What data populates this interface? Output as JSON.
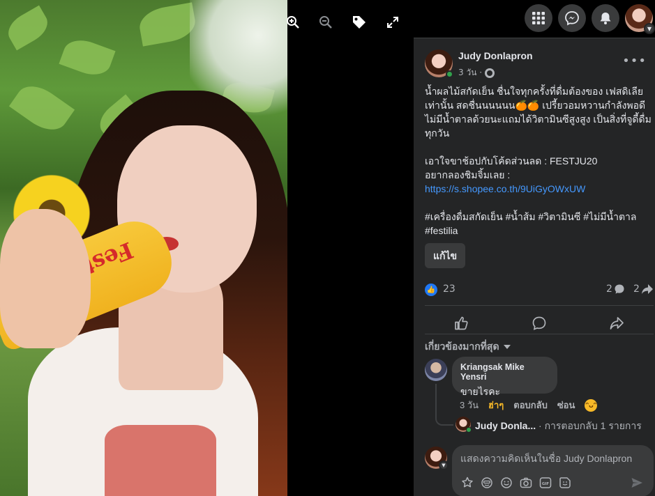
{
  "photo": {
    "alt": "",
    "bottle_brand": "Festilia"
  },
  "photo_controls": {
    "zoom_in": "zoom-in-icon",
    "zoom_out": "zoom-out-icon",
    "tag": "tag-icon",
    "fullscreen": "fullscreen-icon"
  },
  "topnav": {
    "menu": "grid-menu-icon",
    "messenger": "messenger-icon",
    "notifications": "bell-icon"
  },
  "post": {
    "author": "Judy Donlapron",
    "time": "3 วัน ·",
    "text_1": "น้ำผลไม้สกัดเย็น ชื่นใจทุกครั้งที่ดื่มต้องของ เฟสดิเลีย เท่านั้น สดชื่นนนนนน🍊🍊 เปรี้ยวอมหวานกำลังพอดี ไม่มีน้ำตาลด้วยนะแถมได้วิตามินซีสูงสูง เป็นสิ่งที่จูดี้ดื่มทุกวัน",
    "text_2": "เอาใจขาช้อปกับโค้ดส่วนลด : FESTJU20\nอยากลองชิมจิ้มเลย :",
    "link": "https://s.shopee.co.th/9UiGyOWxUW",
    "hashtags": "#เครื่องดื่มสกัดเย็น #น้ำส้ม #วิตามินซี #ไม่มีน้ำตาล #festilia",
    "edit_label": "แก้ไข"
  },
  "stats": {
    "likes": "23",
    "comments": "2",
    "shares": "2"
  },
  "sort_label": "เกี่ยวข้องมากที่สุด",
  "comment": {
    "name": "Kriangsak Mike Yensri",
    "text": "ขายไรคะ",
    "time": "3 วัน",
    "reaction_label": "ฮ่าๆ",
    "reply_label": "ตอบกลับ",
    "hide_label": "ซ่อน"
  },
  "reply_preview": {
    "name": "Judy Donla...",
    "text": " · การตอบกลับ 1 รายการ"
  },
  "composer": {
    "placeholder": "แสดงความคิดเห็นในชื่อ Judy Donlapron"
  },
  "colors": {
    "panel_bg": "#242526",
    "bubble_bg": "#3a3b3c",
    "link": "#4599ff",
    "like_blue": "#2078f4",
    "haha_yellow": "#f7b928",
    "online_green": "#31a24c"
  }
}
